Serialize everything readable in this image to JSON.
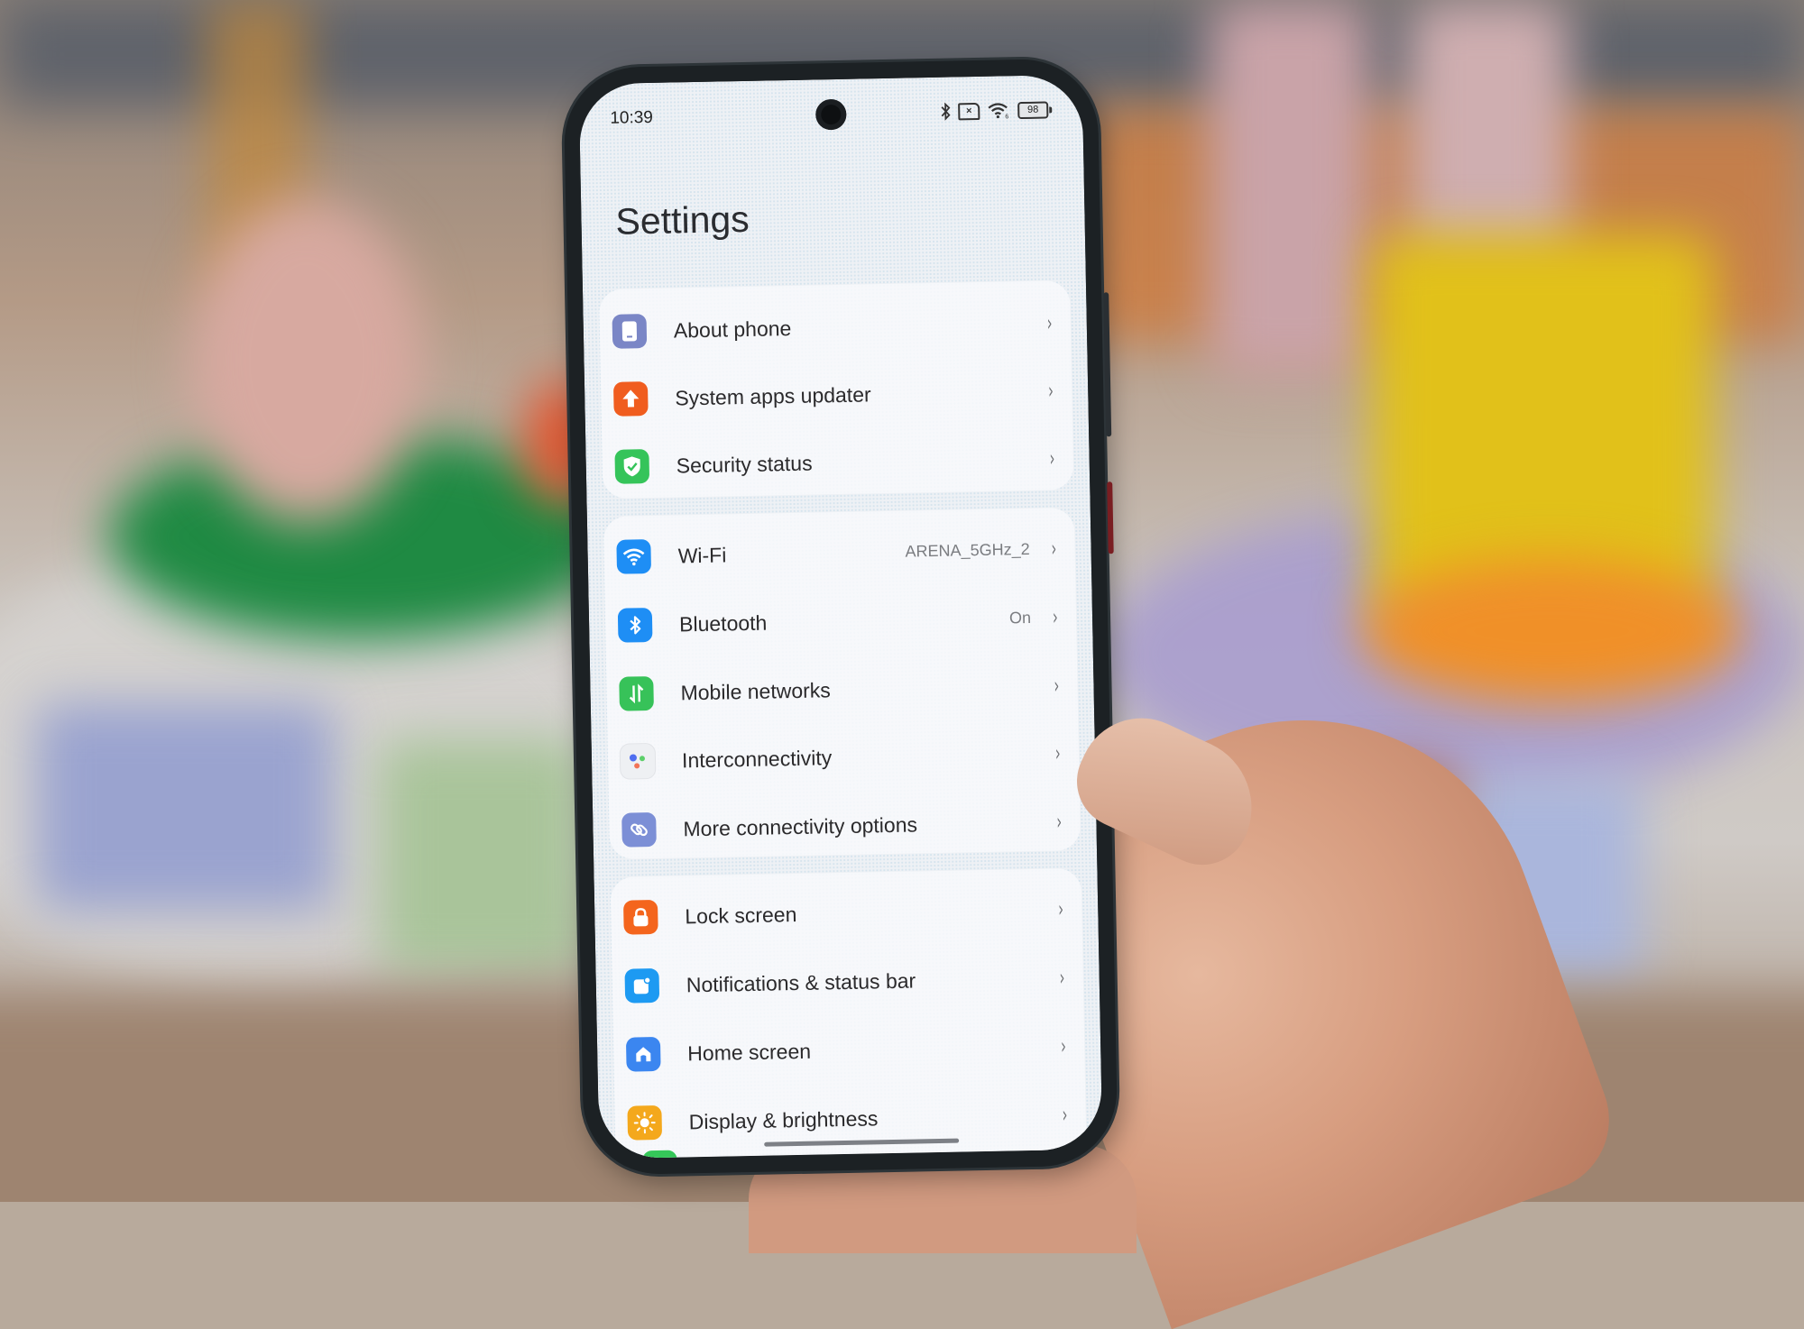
{
  "status_bar": {
    "time": "10:39",
    "icons": [
      "bluetooth-icon",
      "no-sim-icon",
      "wifi-icon",
      "battery-icon"
    ],
    "wifi_badge": "6",
    "battery_level": "98"
  },
  "page_title": "Settings",
  "sections": [
    {
      "items": [
        {
          "label": "About phone",
          "icon": "phone-icon",
          "color": "#7a86c6",
          "value": ""
        },
        {
          "label": "System apps updater",
          "icon": "upload-arrow-icon",
          "color": "#f05d1f",
          "value": ""
        },
        {
          "label": "Security status",
          "icon": "shield-check-icon",
          "color": "#35c45a",
          "value": ""
        }
      ]
    },
    {
      "items": [
        {
          "label": "Wi-Fi",
          "icon": "wifi-icon",
          "color": "#1e8ef5",
          "value": "ARENA_5GHz_2"
        },
        {
          "label": "Bluetooth",
          "icon": "bluetooth-icon",
          "color": "#1e8ef5",
          "value": "On"
        },
        {
          "label": "Mobile networks",
          "icon": "mobile-data-icon",
          "color": "#37c259",
          "value": ""
        },
        {
          "label": "Interconnectivity",
          "icon": "dots-icon",
          "color": "#eef0f3",
          "value": ""
        },
        {
          "label": "More connectivity options",
          "icon": "link-icon",
          "color": "#7c8fd6",
          "value": ""
        }
      ]
    },
    {
      "items": [
        {
          "label": "Lock screen",
          "icon": "lock-icon",
          "color": "#f4651d",
          "value": ""
        },
        {
          "label": "Notifications & status bar",
          "icon": "notification-icon",
          "color": "#1d9af2",
          "value": ""
        },
        {
          "label": "Home screen",
          "icon": "home-icon",
          "color": "#3b86f0",
          "value": ""
        },
        {
          "label": "Display & brightness",
          "icon": "sun-icon",
          "color": "#f4a81c",
          "value": ""
        }
      ]
    }
  ],
  "chevron": "›"
}
